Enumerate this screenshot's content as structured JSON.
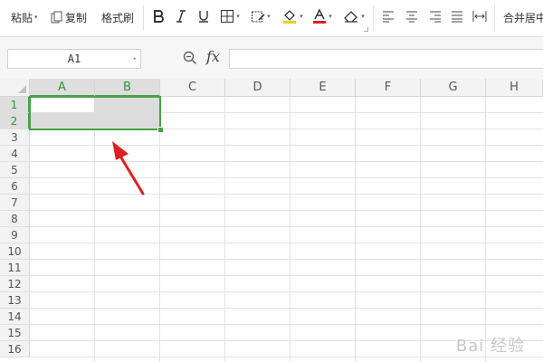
{
  "ribbon": {
    "paste_label": "粘贴",
    "copy_label": "复制",
    "format_painter_label": "格式刷",
    "merge_center_label": "合并居中"
  },
  "formula_bar": {
    "name_box_value": "A1",
    "fx_label": "fx",
    "formula_value": ""
  },
  "sheet": {
    "columns": [
      "A",
      "B",
      "C",
      "D",
      "E",
      "F",
      "G",
      "H"
    ],
    "rows": [
      "1",
      "2",
      "3",
      "4",
      "5",
      "6",
      "7",
      "8",
      "9",
      "10",
      "11",
      "12",
      "13",
      "14",
      "15",
      "16"
    ]
  },
  "colors": {
    "selection_green": "#4aa04a",
    "arrow_red": "#e02020"
  },
  "watermark_text": "Bai 经验"
}
